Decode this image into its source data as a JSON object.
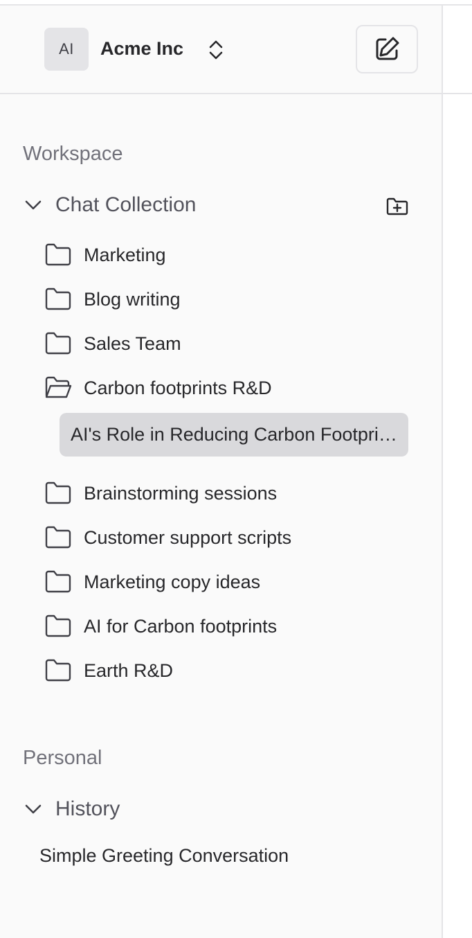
{
  "org": {
    "avatar_initials": "AI",
    "name": "Acme Inc"
  },
  "icons": {
    "org_switch": "chevrons-up-down-icon",
    "compose": "compose-icon",
    "add_folder": "folder-plus-icon",
    "folder": "folder-icon",
    "folder_open": "folder-open-icon",
    "collapse": "chevron-down-icon"
  },
  "workspace": {
    "section_label": "Workspace",
    "group_label": "Chat Collection",
    "folders_before": [
      {
        "label": "Marketing"
      },
      {
        "label": "Blog writing"
      },
      {
        "label": "Sales Team"
      }
    ],
    "open_folder": {
      "label": "Carbon footprints R&D",
      "active_chat": "AI's Role in Reducing Carbon Footprints"
    },
    "folders_after": [
      {
        "label": "Brainstorming sessions"
      },
      {
        "label": "Customer support scripts"
      },
      {
        "label": "Marketing copy ideas"
      },
      {
        "label": "AI for Carbon footprints"
      },
      {
        "label": "Earth R&D"
      }
    ]
  },
  "personal": {
    "section_label": "Personal",
    "group_label": "History",
    "items": [
      {
        "label": "Simple Greeting Conversation"
      }
    ]
  },
  "colors": {
    "sidebar_bg": "#fafafa",
    "active_item_bg": "#d9d9dc",
    "section_label": "#71717a",
    "border": "#e4e4e7"
  }
}
